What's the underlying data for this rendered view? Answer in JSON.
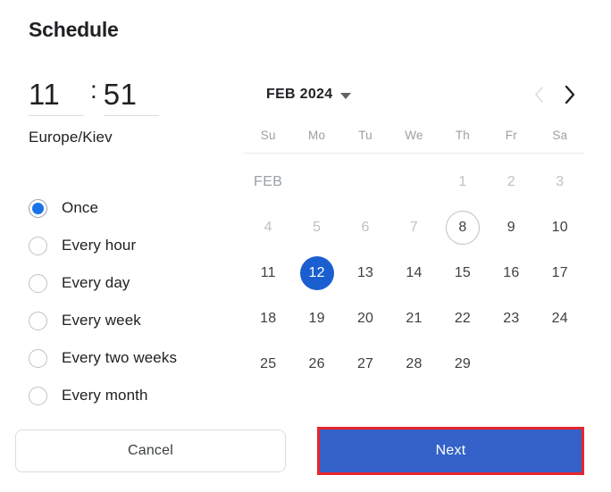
{
  "dialog": {
    "title": "Schedule"
  },
  "time": {
    "hour": "11",
    "separator": ":",
    "minute": "51",
    "timezone": "Europe/Kiev"
  },
  "recurrence": {
    "selected": "Once",
    "options": [
      {
        "label": "Once",
        "checked": true
      },
      {
        "label": "Every hour",
        "checked": false
      },
      {
        "label": "Every day",
        "checked": false
      },
      {
        "label": "Every week",
        "checked": false
      },
      {
        "label": "Every two weeks",
        "checked": false
      },
      {
        "label": "Every month",
        "checked": false
      }
    ]
  },
  "calendar": {
    "month_year_label": "FEB 2024",
    "month_tag": "FEB",
    "prev_icon": "chevron-left-icon",
    "next_icon": "chevron-right-icon",
    "prev_enabled": false,
    "next_enabled": true,
    "weekdays": [
      "Su",
      "Mo",
      "Tu",
      "We",
      "Th",
      "Fr",
      "Sa"
    ],
    "today": "8",
    "selected_day": "12",
    "weeks": [
      [
        {
          "label": "FEB",
          "type": "month-tag"
        },
        {
          "label": "",
          "type": "empty"
        },
        {
          "label": "",
          "type": "empty"
        },
        {
          "label": "",
          "type": "empty"
        },
        {
          "label": "1",
          "type": "disabled"
        },
        {
          "label": "2",
          "type": "disabled"
        },
        {
          "label": "3",
          "type": "disabled"
        }
      ],
      [
        {
          "label": "4",
          "type": "disabled"
        },
        {
          "label": "5",
          "type": "disabled"
        },
        {
          "label": "6",
          "type": "disabled"
        },
        {
          "label": "7",
          "type": "disabled"
        },
        {
          "label": "8",
          "type": "today"
        },
        {
          "label": "9",
          "type": "normal"
        },
        {
          "label": "10",
          "type": "normal"
        }
      ],
      [
        {
          "label": "11",
          "type": "normal"
        },
        {
          "label": "12",
          "type": "selected"
        },
        {
          "label": "13",
          "type": "normal"
        },
        {
          "label": "14",
          "type": "normal"
        },
        {
          "label": "15",
          "type": "normal"
        },
        {
          "label": "16",
          "type": "normal"
        },
        {
          "label": "17",
          "type": "normal"
        }
      ],
      [
        {
          "label": "18",
          "type": "normal"
        },
        {
          "label": "19",
          "type": "normal"
        },
        {
          "label": "20",
          "type": "normal"
        },
        {
          "label": "21",
          "type": "normal"
        },
        {
          "label": "22",
          "type": "normal"
        },
        {
          "label": "23",
          "type": "normal"
        },
        {
          "label": "24",
          "type": "normal"
        }
      ],
      [
        {
          "label": "25",
          "type": "normal"
        },
        {
          "label": "26",
          "type": "normal"
        },
        {
          "label": "27",
          "type": "normal"
        },
        {
          "label": "28",
          "type": "normal"
        },
        {
          "label": "29",
          "type": "normal"
        },
        {
          "label": "",
          "type": "empty"
        },
        {
          "label": "",
          "type": "empty"
        }
      ]
    ]
  },
  "footer": {
    "cancel_label": "Cancel",
    "next_label": "Next"
  },
  "colors": {
    "accent_blue": "#1a73e8",
    "selected_day_blue": "#1a5fd0",
    "next_button_blue": "#3462c8",
    "highlight_red": "#e8262c",
    "muted_text": "#9aa0a6",
    "body_text": "#202124"
  }
}
